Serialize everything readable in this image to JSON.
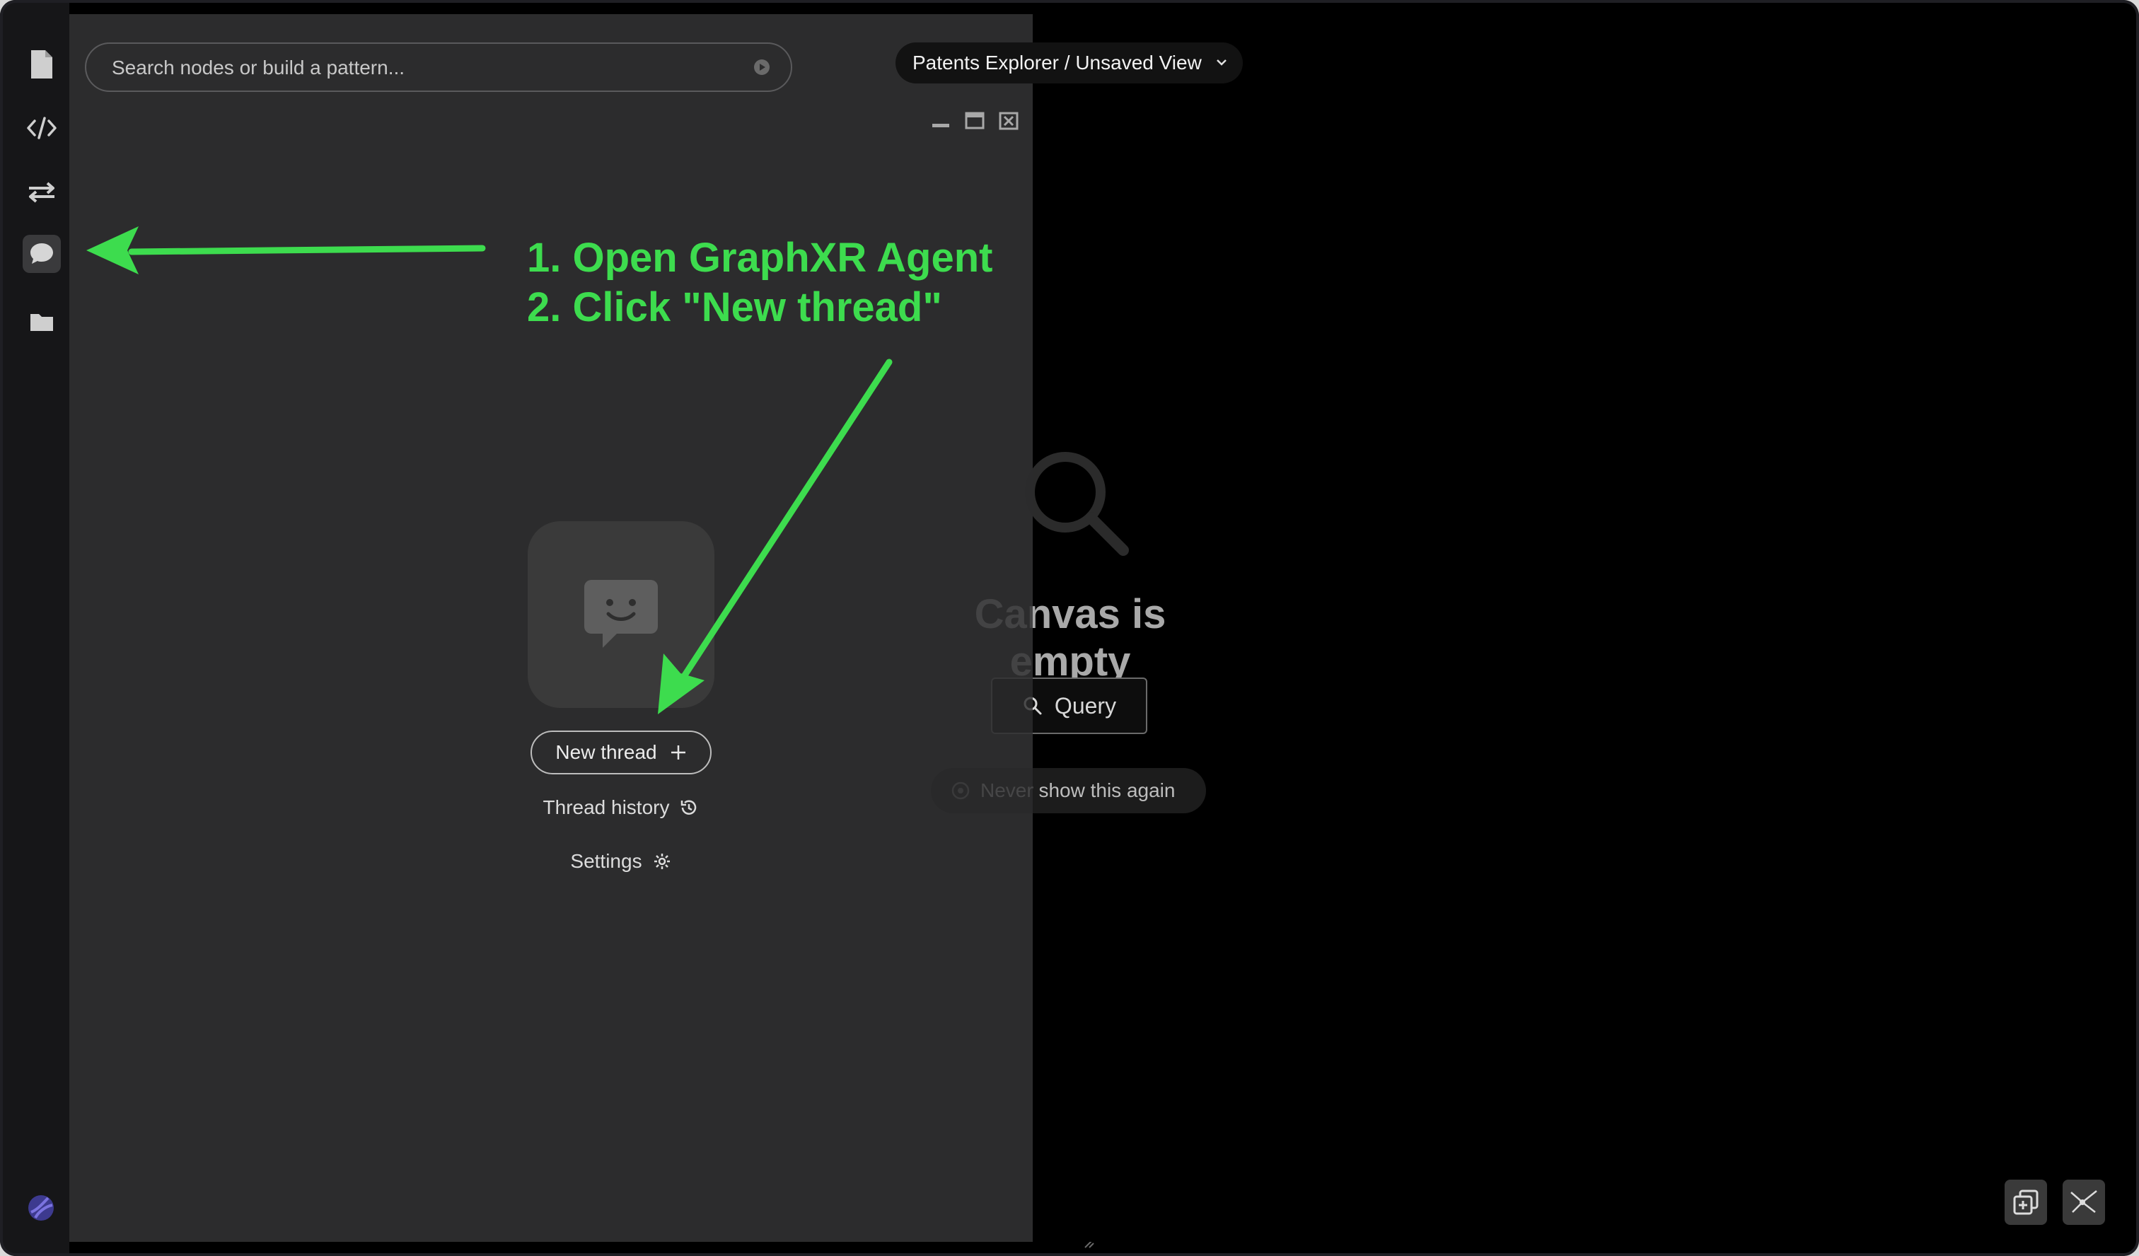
{
  "search": {
    "placeholder": "Search nodes or build a pattern..."
  },
  "breadcrumb": {
    "label": "Patents Explorer / Unsaved View"
  },
  "rail": {
    "items": [
      {
        "name": "document-icon"
      },
      {
        "name": "code-icon"
      },
      {
        "name": "transfer-arrows-icon"
      },
      {
        "name": "chat-bubble-icon",
        "active": true
      },
      {
        "name": "folder-icon"
      }
    ]
  },
  "agent": {
    "new_thread_label": "New thread",
    "thread_history_label": "Thread history",
    "settings_label": "Settings"
  },
  "canvas": {
    "empty_title": "Canvas is empty",
    "query_label": "Query",
    "never_show_label": "Never show this again"
  },
  "annotation": {
    "line1": "1. Open GraphXR Agent",
    "line2": "2. Click \"New thread\""
  },
  "colors": {
    "annotation_green": "#3ddc4e",
    "panel_bg": "#2c2c2d",
    "rail_bg": "#161618",
    "canvas_bg": "#000000"
  }
}
